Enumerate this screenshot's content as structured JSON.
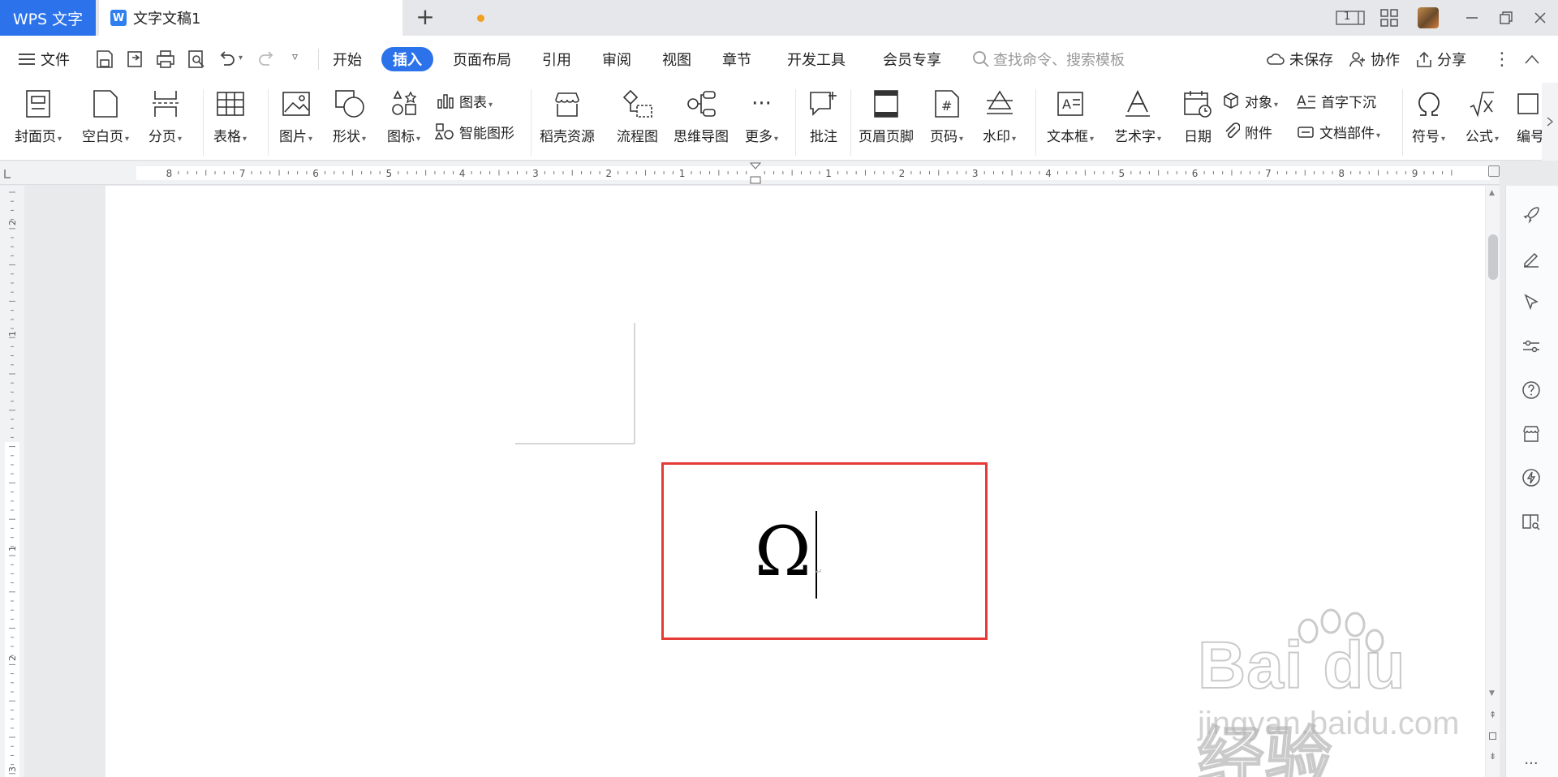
{
  "titlebar": {
    "app_tab": "WPS 文字",
    "doc_tab": "文字文稿1",
    "doc_icon": "W",
    "page_indicator": "1",
    "icons": [
      "layout-icon",
      "grid-apps-icon",
      "avatar",
      "minimize-icon",
      "restore-icon",
      "close-icon"
    ]
  },
  "menubar": {
    "file": "文件",
    "tabs": [
      "开始",
      "插入",
      "页面布局",
      "引用",
      "审阅",
      "视图",
      "章节",
      "开发工具",
      "会员专享"
    ],
    "active_tab": "插入",
    "search_placeholder": "查找命令、搜索模板",
    "unsaved": "未保存",
    "collaborate": "协作",
    "share": "分享"
  },
  "ribbon": {
    "cover": "封面页",
    "blank": "空白页",
    "pagebreak": "分页",
    "table": "表格",
    "picture": "图片",
    "shape": "形状",
    "icon": "图标",
    "chart": "图表",
    "smartart": "智能图形",
    "resource": "稻壳资源",
    "flow": "流程图",
    "mindmap": "思维导图",
    "more": "更多",
    "comment": "批注",
    "header": "页眉页脚",
    "pagenum": "页码",
    "watermark": "水印",
    "textbox": "文本框",
    "wordart": "艺术字",
    "date": "日期",
    "object": "对象",
    "attach": "附件",
    "dropcap": "首字下沉",
    "docpart": "文档部件",
    "symbol": "符号",
    "formula": "公式",
    "edit": "编号"
  },
  "ruler": {
    "labels": [
      "8",
      "7",
      "6",
      "5",
      "4",
      "3",
      "2",
      "1",
      "1",
      "2",
      "3",
      "4",
      "5",
      "6",
      "7",
      "8",
      "9"
    ]
  },
  "vruler": {
    "labels": [
      "2",
      "1",
      "1",
      "2",
      "3"
    ]
  },
  "document": {
    "content": "Ω"
  },
  "watermark": {
    "logo": "Bai du 经验",
    "url": "jingyan.baidu.com"
  },
  "colors": {
    "accent": "#2c73eb",
    "highlight": "#e53a36",
    "unsaved_dot": "#f0a020"
  }
}
